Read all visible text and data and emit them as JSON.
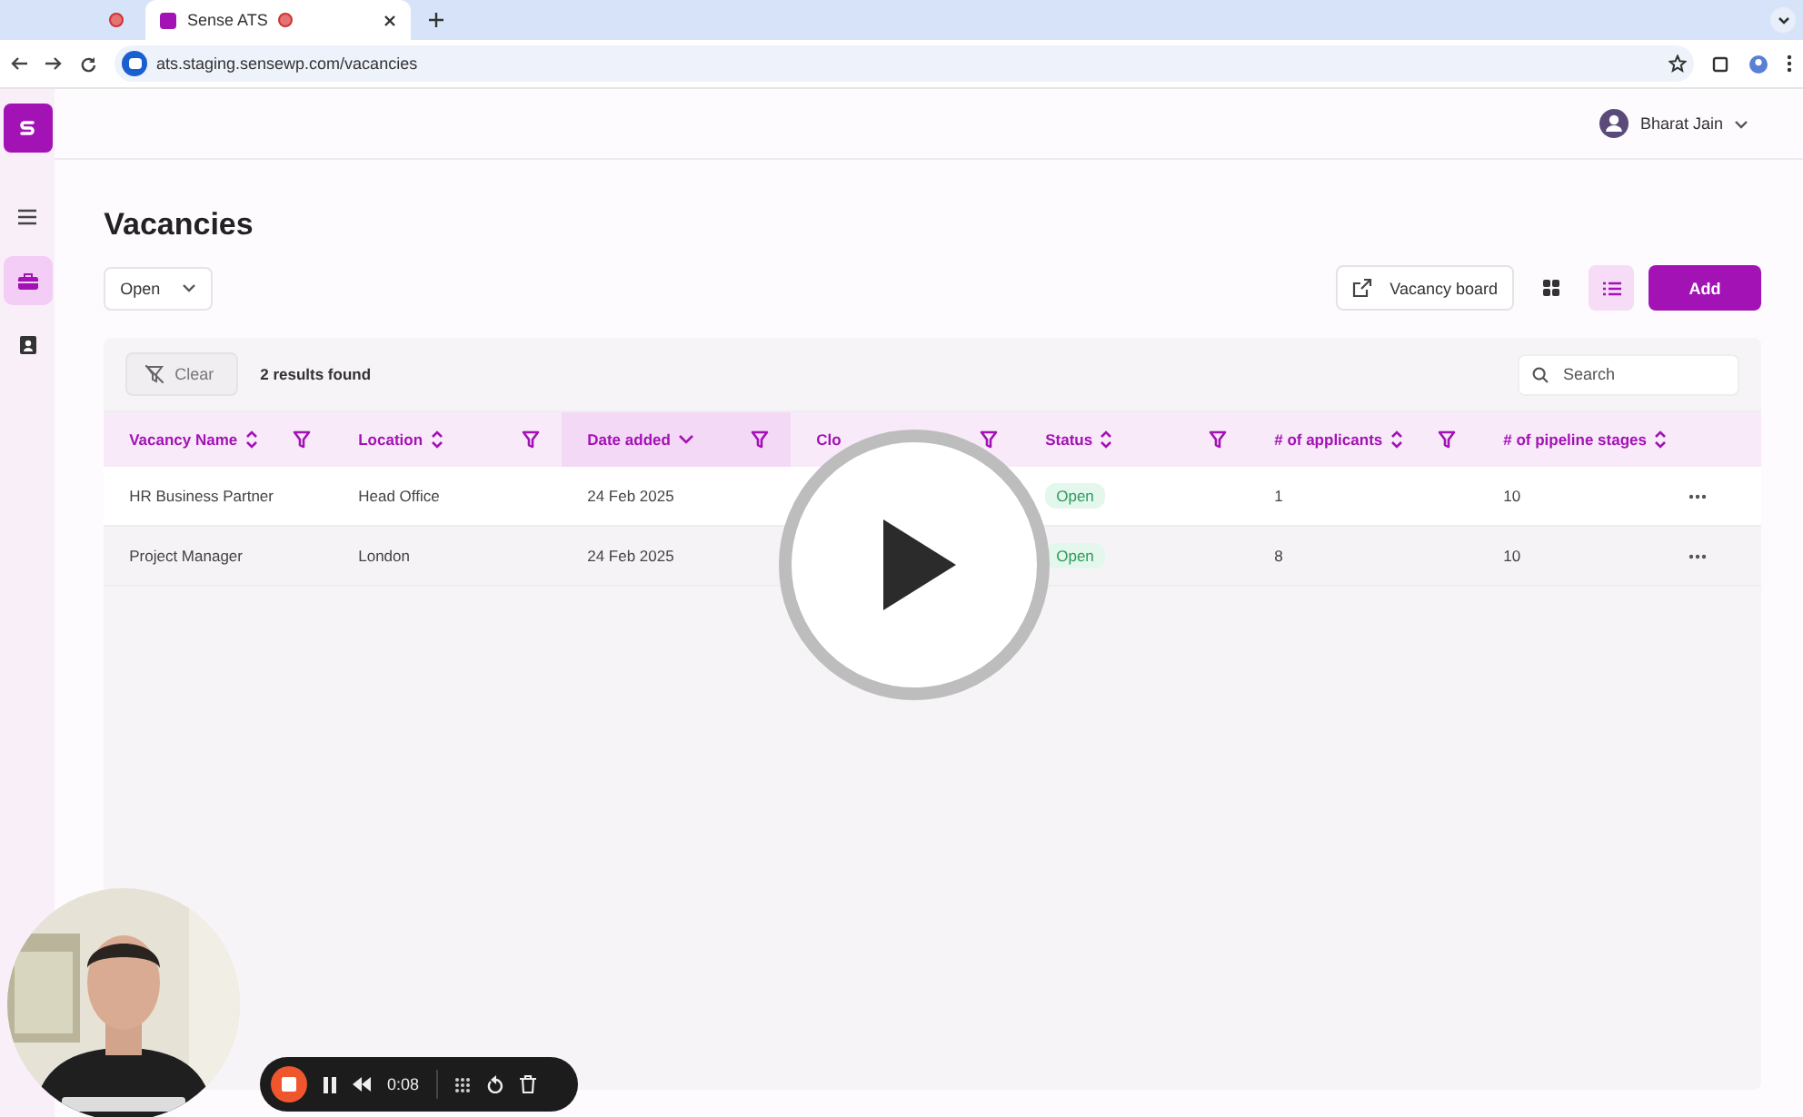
{
  "browser": {
    "tabs": [
      {
        "kind": "icon-only",
        "selected": false
      },
      {
        "kind": "page",
        "title": "Sense ATS",
        "selected": true
      }
    ],
    "address": "ats.staging.sensewp.com/vacancies"
  },
  "sidebar": {
    "items": [
      {
        "kind": "menu",
        "selected": false
      },
      {
        "kind": "vacancies",
        "selected": true
      },
      {
        "kind": "contacts",
        "selected": false
      }
    ]
  },
  "header": {
    "user": "Bharat Jain"
  },
  "page": {
    "title": "Vacancies",
    "status_filter": "Open",
    "vacancy_board_button": "Vacancy board",
    "views": [
      {
        "kind": "grid",
        "selected": false
      },
      {
        "kind": "list",
        "selected": true
      }
    ],
    "add_button": "Add"
  },
  "table": {
    "clear_button": "Clear",
    "results": "2 results found",
    "search": {
      "placeholder": "Search"
    },
    "columns": [
      {
        "label": "Vacancy Name",
        "sorted": false,
        "filter": true
      },
      {
        "label": "Location",
        "sorted": false,
        "filter": true
      },
      {
        "label": "Date added",
        "sorted": true,
        "filter": true
      },
      {
        "label": "Clo",
        "filter": true
      },
      {
        "label": "Status",
        "sorted": false,
        "filter": true
      },
      {
        "label": "# of applicants",
        "sorted": false,
        "filter": true
      },
      {
        "label": "# of pipeline stages",
        "sorted": false,
        "filter": false
      }
    ],
    "rows": [
      {
        "vacancy_name": "HR Business Partner",
        "location": "Head Office",
        "date_added": "24 Feb 2025",
        "status": "Open",
        "applicants": "1",
        "pipeline_stages": "10",
        "hovered": false
      },
      {
        "vacancy_name": "Project Manager",
        "location": "London",
        "date_added": "24 Feb 2025",
        "status": "Open",
        "applicants": "8",
        "pipeline_stages": "10",
        "hovered": true
      }
    ]
  },
  "recorder": {
    "time": "0:08"
  }
}
